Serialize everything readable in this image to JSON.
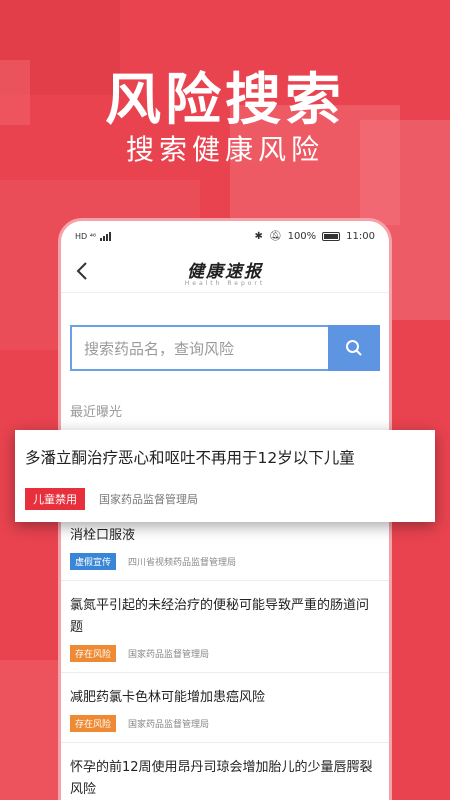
{
  "hero": {
    "title": "风险搜索",
    "subtitle": "搜索健康风险"
  },
  "status_bar": {
    "left": "HD ⁴⁶",
    "battery_pct": "100%",
    "time": "11:00"
  },
  "navbar": {
    "logo_main": "健康速报",
    "logo_en": "Health Report"
  },
  "search": {
    "placeholder": "搜索药品名，查询风险"
  },
  "section_label": "最近曝光",
  "popup": {
    "title": "多潘立酮治疗恶心和呕吐不再用于12岁以下儿童",
    "tag": "儿童禁用",
    "source": "国家药品监督管理局"
  },
  "items": [
    {
      "title": "消栓口服液",
      "tag": "虚假宣传",
      "tag_color": "#3a86d6",
      "source": "四川省视频药品监督管理局"
    },
    {
      "title": "氯氮平引起的未经治疗的便秘可能导致严重的肠道问题",
      "tag": "存在风险",
      "tag_color": "#ee8a34",
      "source": "国家药品监督管理局"
    },
    {
      "title": "减肥药氯卡色林可能增加患癌风险",
      "tag": "存在风险",
      "tag_color": "#ee8a34",
      "source": "国家药品监督管理局"
    },
    {
      "title": "怀孕的前12周使用昂丹司琼会增加胎儿的少量唇腭裂风险"
    }
  ],
  "colors": {
    "background": "#e8434f",
    "search_accent": "#5e95e3",
    "popup_tag": "#e8303d"
  }
}
